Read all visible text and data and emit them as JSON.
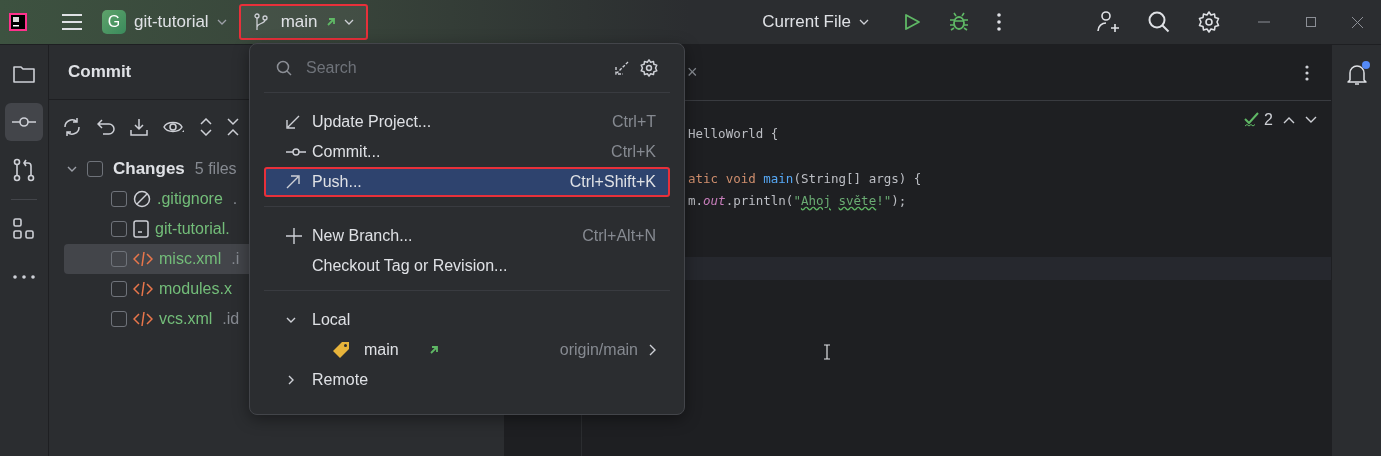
{
  "title_bar": {
    "project": {
      "badge": "G",
      "name": "git-tutorial"
    },
    "branch": {
      "name": "main",
      "highlighted": true
    },
    "run_config": "Current File"
  },
  "left_strip": [
    {
      "kind": "folder",
      "selected": false
    },
    {
      "kind": "commit",
      "selected": true
    },
    {
      "kind": "pull-request",
      "selected": false
    },
    {
      "kind": "structure",
      "selected": false
    },
    {
      "kind": "more",
      "selected": false
    }
  ],
  "commit_panel": {
    "title": "Commit",
    "changes": {
      "label": "Changes",
      "count": "5 files",
      "expanded": true,
      "checked": false,
      "files": [
        {
          "kind": "ignore",
          "name": ".gitignore",
          "location": ".",
          "checked": false,
          "selected": false
        },
        {
          "kind": "module",
          "name": "git-tutorial.",
          "checked": false,
          "selected": false
        },
        {
          "kind": "xml",
          "name": "misc.xml",
          "location": ".i",
          "checked": false,
          "selected": true
        },
        {
          "kind": "xml",
          "name": "modules.x",
          "checked": false,
          "selected": false
        },
        {
          "kind": "xml",
          "name": "vcs.xml",
          "location": ".id",
          "checked": false,
          "selected": false
        }
      ]
    }
  },
  "branch_popup": {
    "search": {
      "placeholder": "Search"
    },
    "sections": [
      [
        {
          "kind": "update",
          "label": "Update Project...",
          "shortcut": "Ctrl+T",
          "highlighted": false,
          "selected": false
        },
        {
          "kind": "commit",
          "label": "Commit...",
          "shortcut": "Ctrl+K",
          "highlighted": false,
          "selected": false
        },
        {
          "kind": "push",
          "label": "Push...",
          "shortcut": "Ctrl+Shift+K",
          "highlighted": true,
          "selected": true
        }
      ],
      [
        {
          "kind": "plus",
          "label": "New Branch...",
          "shortcut": "Ctrl+Alt+N",
          "highlighted": false,
          "selected": false
        },
        {
          "kind": "plain",
          "label": "Checkout Tag or Revision...",
          "highlighted": false,
          "selected": false
        }
      ],
      [
        {
          "kind": "group",
          "label": "Local",
          "expanded": true
        },
        {
          "kind": "branch",
          "label": "main",
          "remote": "origin/main"
        },
        {
          "kind": "group",
          "label": "Remote",
          "expanded": false
        }
      ]
    ]
  },
  "editor": {
    "tab_close": "×",
    "problems": "2",
    "lines": [
      {
        "kind": "code",
        "current": false,
        "tokens": [
          {
            "kind": "plain",
            "s": "HelloWorld {"
          }
        ]
      },
      {
        "kind": "blank",
        "current": false
      },
      {
        "kind": "code",
        "current": false,
        "tokens": [
          {
            "kind": "keyword",
            "s": "atic void "
          },
          {
            "kind": "method",
            "s": "main"
          },
          {
            "kind": "plain",
            "s": "(String[] args) {"
          }
        ]
      },
      {
        "kind": "code",
        "current": false,
        "tokens": [
          {
            "kind": "plain",
            "s": "m."
          },
          {
            "kind": "field",
            "s": "out"
          },
          {
            "kind": "plain",
            "s": ".println("
          },
          {
            "kind": "string",
            "s": "\""
          },
          {
            "kind": "typo",
            "s": "Ahoj"
          },
          {
            "kind": "typo",
            "s": " světe"
          },
          {
            "kind": "string",
            "s": "!\""
          },
          {
            "kind": "plain",
            "s": ");"
          }
        ]
      },
      {
        "kind": "blank",
        "current": false
      },
      {
        "kind": "blank",
        "current": false
      },
      {
        "kind": "blank",
        "current": true
      }
    ]
  },
  "notifications": {
    "unread": true
  }
}
